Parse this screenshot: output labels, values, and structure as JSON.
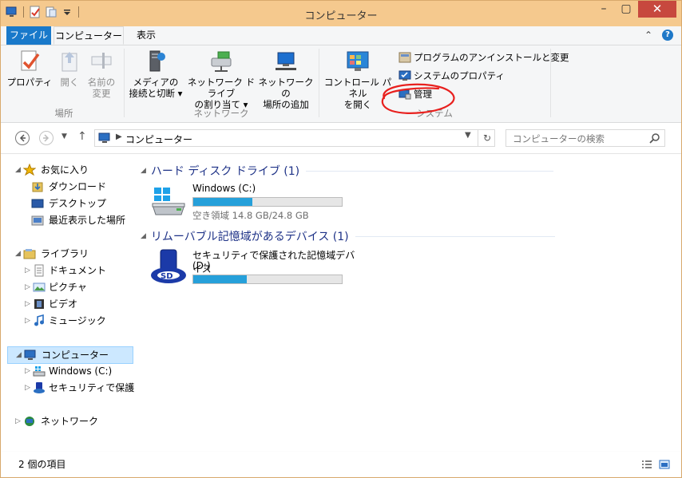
{
  "window": {
    "title": "コンピューター",
    "controls": {
      "minimize": "–",
      "maximize": "▢",
      "close": "✕"
    }
  },
  "quick_access": {
    "icons": [
      "properties-icon",
      "new-folder-icon",
      "customize-dropdown-icon"
    ]
  },
  "ribbon_tabs": [
    {
      "label": "ファイル",
      "active": false
    },
    {
      "label": "コンピューター",
      "active": true
    },
    {
      "label": "表示",
      "active": false
    }
  ],
  "ribbon": {
    "groups": [
      {
        "label": "場所",
        "buttons": [
          {
            "line1": "プロパティ",
            "line2": "",
            "enabled": true
          },
          {
            "line1": "開く",
            "line2": "",
            "enabled": false
          },
          {
            "line1": "名前の",
            "line2": "変更",
            "enabled": false
          }
        ]
      },
      {
        "label": "ネットワーク",
        "buttons": [
          {
            "line1": "メディアの",
            "line2": "接続と切断 ▾"
          },
          {
            "line1": "ネットワーク ドライブ",
            "line2": "の割り当て ▾"
          },
          {
            "line1": "ネットワークの",
            "line2": "場所の追加"
          }
        ]
      },
      {
        "label": "システム",
        "buttons": [
          {
            "line1": "コントロール パネル",
            "line2": "を開く"
          }
        ],
        "small_items": [
          "プログラムのアンインストールと変更",
          "システムのプロパティ",
          "管理"
        ]
      }
    ]
  },
  "address": {
    "path": "コンピューター",
    "search_placeholder": "コンピューターの検索"
  },
  "nav_pane": {
    "favorites": {
      "label": "お気に入り",
      "items": [
        "ダウンロード",
        "デスクトップ",
        "最近表示した場所"
      ]
    },
    "libraries": {
      "label": "ライブラリ",
      "items": [
        "ドキュメント",
        "ピクチャ",
        "ビデオ",
        "ミュージック"
      ]
    },
    "computer": {
      "label": "コンピューター",
      "items": [
        "Windows (C:)",
        "セキュリティで保護され"
      ]
    },
    "network": {
      "label": "ネットワーク"
    }
  },
  "content": {
    "groups": [
      {
        "header": "ハード ディスク ドライブ (1)",
        "drives": [
          {
            "name": "Windows (C:)",
            "free_text": "空き領域 14.8 GB/24.8 GB",
            "used_fraction": 0.4
          }
        ]
      },
      {
        "header": "リムーバブル記憶域があるデバイス (1)",
        "drives": [
          {
            "name_line1": "セキュリティで保護された記憶域デバイス",
            "name_line2": "(D:)",
            "used_fraction": 0.36
          }
        ]
      }
    ]
  },
  "status": {
    "items_text": "2 個の項目"
  },
  "colors": {
    "titlebar": "#f5c98e",
    "file_tab": "#1979ca",
    "progress": "#26a0da",
    "selection": "#cce8ff",
    "annotation": "#e8201e"
  }
}
